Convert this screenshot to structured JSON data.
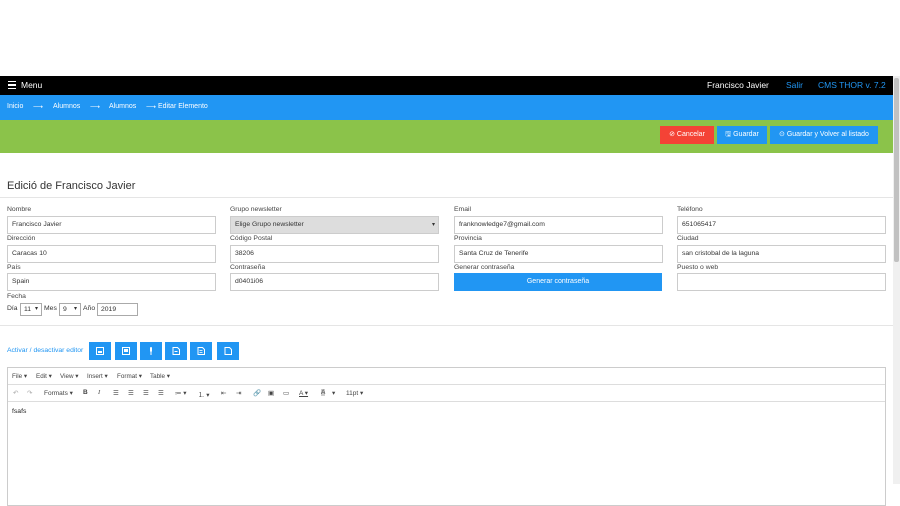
{
  "topbar": {
    "menu": "Menu",
    "user": "Francisco Javier",
    "logout": "Salir",
    "cms": "CMS THOR v. 7.2"
  },
  "breadcrumb": {
    "items": [
      "Inicio",
      "Alumnos",
      "Alumnos",
      "Editar Elemento"
    ],
    "separator": "⟶"
  },
  "actions": {
    "cancel": "Cancelar",
    "save": "Guardar",
    "save_back": "Guardar y Volver al listado"
  },
  "form": {
    "title": "Edició de Francisco Javier",
    "nombre": {
      "label": "Nombre",
      "value": "Francisco Javier"
    },
    "grupo": {
      "label": "Grupo newsletter",
      "value": "Elige Grupo newsletter"
    },
    "email": {
      "label": "Email",
      "value": "franknowledge7@gmail.com"
    },
    "telefono": {
      "label": "Teléfono",
      "value": "651065417"
    },
    "direccion": {
      "label": "Dirección",
      "value": "Caracas 10"
    },
    "cp": {
      "label": "Código Postal",
      "value": "38206"
    },
    "provincia": {
      "label": "Provincia",
      "value": "Santa Cruz de Tenerife"
    },
    "ciudad": {
      "label": "Ciudad",
      "value": "san cristobal de la laguna"
    },
    "pais": {
      "label": "País",
      "value": "Spain"
    },
    "password": {
      "label": "Contraseña",
      "value": "d0401i06"
    },
    "gen_password": {
      "label": "Generar contraseña",
      "button": "Generar contraseña"
    },
    "puesto": {
      "label": "Puesto o web",
      "value": ""
    },
    "fecha": {
      "label": "Fecha",
      "dia_label": "Día",
      "dia": "11",
      "mes_label": "Mes",
      "mes": "9",
      "anio_label": "Año",
      "anio": "2019"
    }
  },
  "editor": {
    "toggle": "Activar / desactivar editor",
    "menus": [
      "File",
      "Edit",
      "View",
      "Insert",
      "Format",
      "Table"
    ],
    "formats": "Formats",
    "font_size": "11pt",
    "content": "fsafs"
  },
  "colors": {
    "blue": "#2196f3",
    "green": "#8bc34a",
    "red": "#f44336",
    "black": "#000000"
  }
}
